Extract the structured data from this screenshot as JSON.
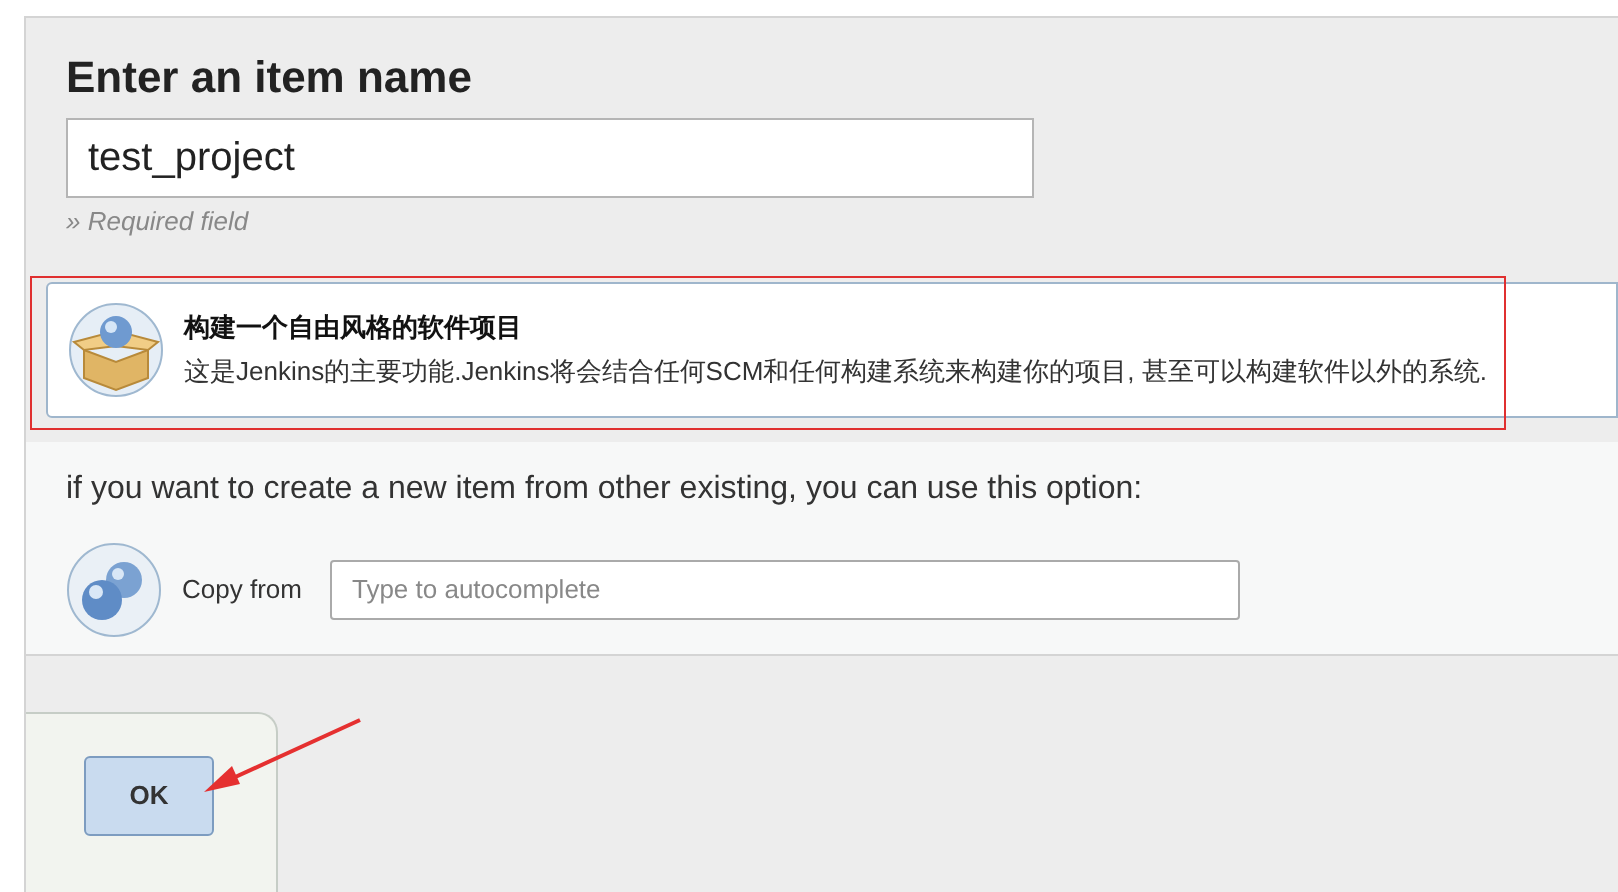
{
  "heading": "Enter an item name",
  "name_field": {
    "value": "test_project"
  },
  "required_note": "» Required field",
  "item_types": [
    {
      "title": "构建一个自由风格的软件项目",
      "description": "这是Jenkins的主要功能.Jenkins将会结合任何SCM和任何构建系统来构建你的项目, 甚至可以构建软件以外的系统.",
      "selected": false
    }
  ],
  "copy_hint": "if you want to create a new item from other existing, you can use this option:",
  "copy_from": {
    "label": "Copy from",
    "placeholder": "Type to autocomplete"
  },
  "ok_button": "OK"
}
